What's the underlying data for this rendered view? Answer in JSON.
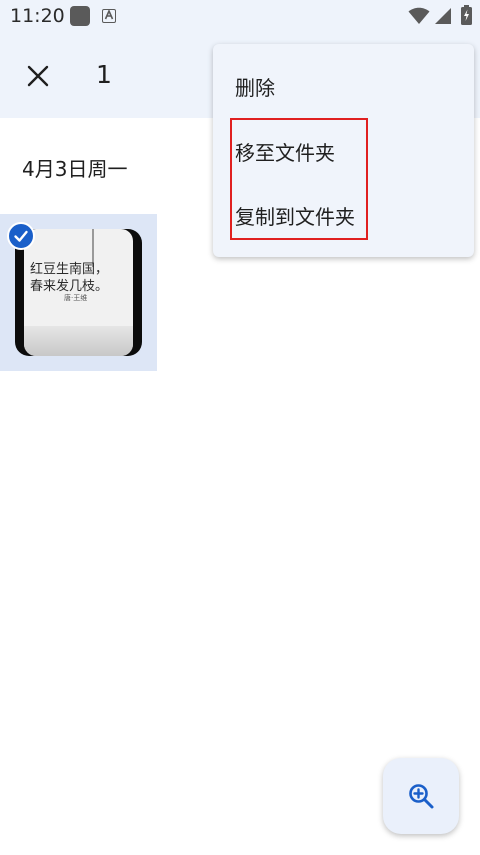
{
  "status_bar": {
    "time": "11:20",
    "icons": [
      "notification-square-icon",
      "a-keyboard-icon",
      "wifi-icon",
      "signal-icon",
      "battery-charging-icon"
    ]
  },
  "app_bar": {
    "close_icon": "close-icon",
    "selected_count": "1"
  },
  "gallery": {
    "date_header": "4月3日周一",
    "photo": {
      "poem_line_1": "红豆生南国，",
      "poem_line_2": "春来发几枝。",
      "author": "唐·王维",
      "selected": true
    }
  },
  "menu": {
    "items": [
      {
        "label": "删除"
      },
      {
        "label": "移至文件夹"
      },
      {
        "label": "复制到文件夹"
      }
    ]
  },
  "fab": {
    "icon": "zoom-in-icon"
  },
  "colors": {
    "app_bar_bg": "#eef3fb",
    "selected_tile_bg": "#dde6f6",
    "accent": "#1a5fc9",
    "highlight": "#e02020"
  }
}
